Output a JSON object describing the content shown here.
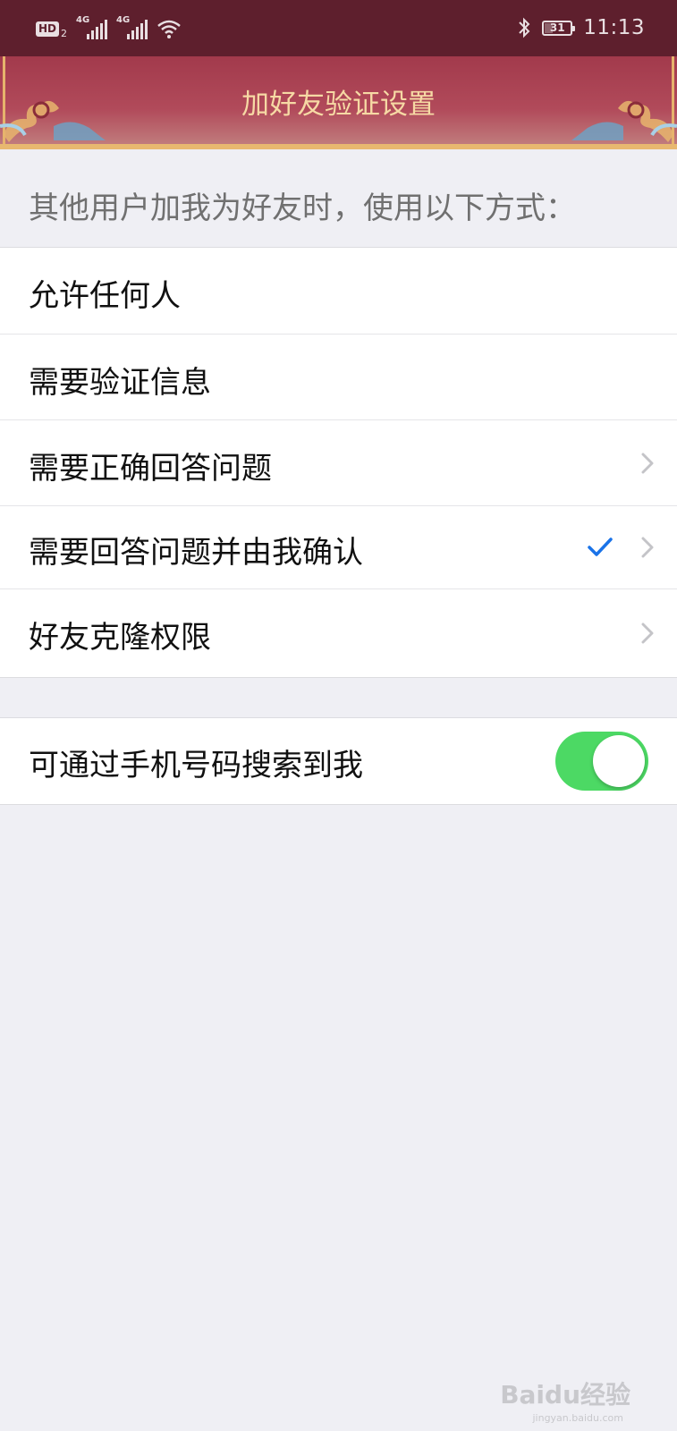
{
  "status_bar": {
    "hd_badge": "HD",
    "sim_number": "2",
    "network_1": "4G",
    "network_2": "4G",
    "battery_level": "31",
    "time": "11:13"
  },
  "header": {
    "title": "加好友验证设置"
  },
  "section": {
    "header": "其他用户加我为好友时，使用以下方式："
  },
  "options": [
    {
      "label": "允许任何人",
      "checked": false,
      "has_chevron": false
    },
    {
      "label": "需要验证信息",
      "checked": false,
      "has_chevron": false
    },
    {
      "label": "需要正确回答问题",
      "checked": false,
      "has_chevron": true
    },
    {
      "label": "需要回答问题并由我确认",
      "checked": true,
      "has_chevron": true
    },
    {
      "label": "好友克隆权限",
      "checked": false,
      "has_chevron": true
    }
  ],
  "phone_search": {
    "label": "可通过手机号码搜索到我",
    "enabled": true
  },
  "watermark": {
    "text": "Baidu经验",
    "url_text": "jingyan.baidu.com"
  },
  "colors": {
    "status_bar": "#5e1f2d",
    "title_bar": "#a23a4c",
    "title_text": "#f6d9a4",
    "check": "#1a73e8",
    "toggle_on": "#4cd964"
  }
}
